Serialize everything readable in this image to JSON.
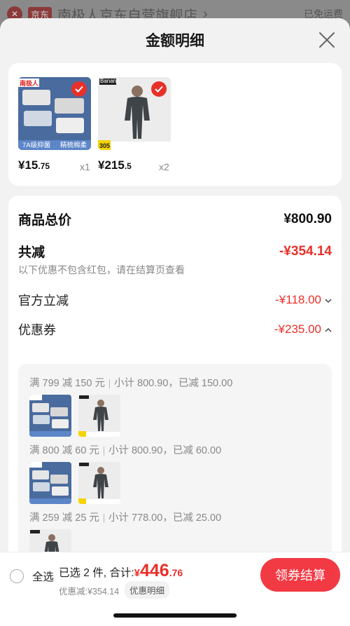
{
  "background_page": {
    "store_tag": "京东",
    "store_name": "南极人京东自营旗舰店",
    "chevron": "›",
    "shipping": "已免运费"
  },
  "sheet": {
    "title": "金额明细",
    "close_icon": "close-icon"
  },
  "products": [
    {
      "price_main": "¥15",
      "price_dec": ".75",
      "qty": "x1",
      "brand": "南极人",
      "badge_left": "7A级抑菌",
      "badge_right": "精梳棉柔",
      "checked": true
    },
    {
      "price_main": "¥215",
      "price_dec": ".5",
      "qty": "x2",
      "brand": "Banana",
      "badge_left": "305",
      "checked": true
    }
  ],
  "breakdown": {
    "total_label": "商品总价",
    "total_value": "¥800.90",
    "reduce_label": "共减",
    "reduce_value": "-¥354.14",
    "note": "以下优惠不包含红包，请在结算页查看",
    "official_label": "官方立减",
    "official_value": "-¥118.00",
    "coupon_label": "优惠券",
    "coupon_value": "-¥235.00"
  },
  "coupons": [
    {
      "rule": "满 799 减 150 元",
      "detail": "小计 800.90，已减 150.00"
    },
    {
      "rule": "满 800 减 60 元",
      "detail": "小计 800.90，已减 60.00"
    },
    {
      "rule": "满 259 减 25 元",
      "detail": "小计 778.00，已减 25.00"
    }
  ],
  "bottom_bar": {
    "select_all": "全选",
    "selected_text": "已选 2 件, 合计:",
    "yen": "¥",
    "total_int": "446",
    "total_dec": ".76",
    "discount_text": "优惠减:¥354.14",
    "detail_link": "优惠明细",
    "checkout_button": "领券结算"
  },
  "colors": {
    "accent_red": "#e8302a",
    "button_red": "#f23a44"
  }
}
